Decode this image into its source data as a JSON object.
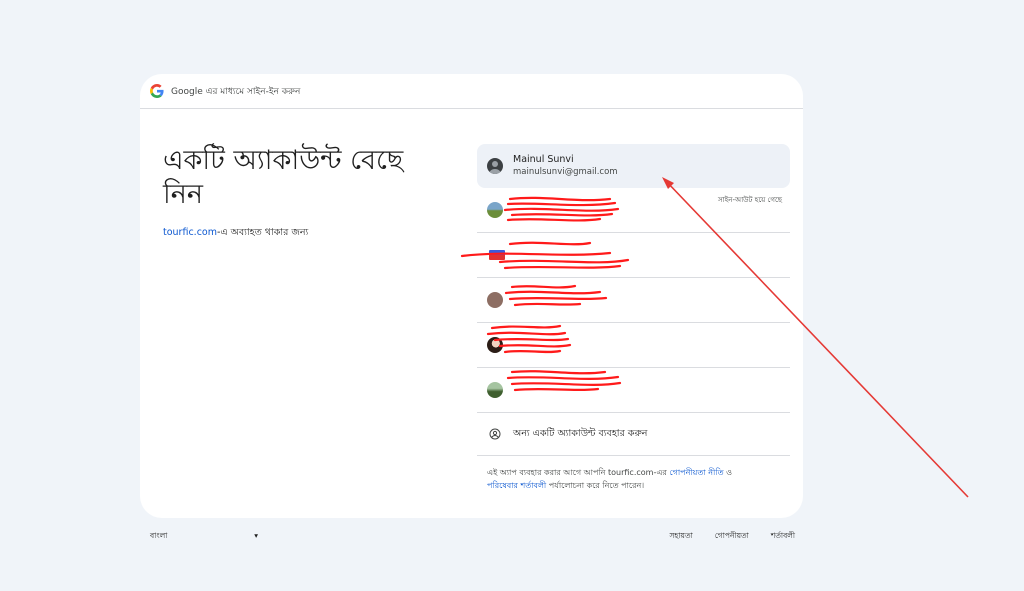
{
  "header": {
    "title": "Google এর মাধ্যমে সাইন-ইন করুন"
  },
  "main": {
    "heading": "একটি অ্যাকাউন্ট বেছে নিন",
    "site": "tourfic.com",
    "subtitle_suffix": "-এ অব্যাহত থাকার জন্য"
  },
  "accounts": [
    {
      "name": "Mainul Sunvi",
      "email": "mainulsunvi@gmail.com",
      "selected": true,
      "avatar": "person-silhouette"
    },
    {
      "name": "",
      "email": "",
      "status": "সাইন-আউট হয়ে গেছে",
      "redacted": true,
      "avatar": "landscape-photo"
    },
    {
      "name": "",
      "email": "",
      "redacted": true,
      "avatar": "flag-avatar"
    },
    {
      "name": "",
      "email": "",
      "redacted": true,
      "avatar": "letter-avatar"
    },
    {
      "name": "",
      "email": "",
      "redacted": true,
      "avatar": "portrait-photo"
    },
    {
      "name": "",
      "email": "",
      "redacted": true,
      "avatar": "outdoor-photo"
    }
  ],
  "use_other": {
    "label": "অন্য একটি অ্যাকাউন্ট ব্যবহার করুন",
    "icon": "account-circle-icon"
  },
  "privacy": {
    "prefix": "এই অ্যাপ ব্যবহার করার আগে আপনি tourfic.com-এর",
    "privacy_link": "গোপনীয়তা নীতি",
    "and": "ও",
    "terms_link": "পরিষেবার শর্তাবলী",
    "suffix": "পর্যালোচনা করে নিতে পারেন।"
  },
  "footer": {
    "language": "বাংলা",
    "links": [
      "সহায়তা",
      "গোপনীয়তা",
      "শর্তাবলী"
    ]
  },
  "colors": {
    "link": "#0b57d0",
    "annotation": "#e53935",
    "background": "#f0f4f9"
  }
}
